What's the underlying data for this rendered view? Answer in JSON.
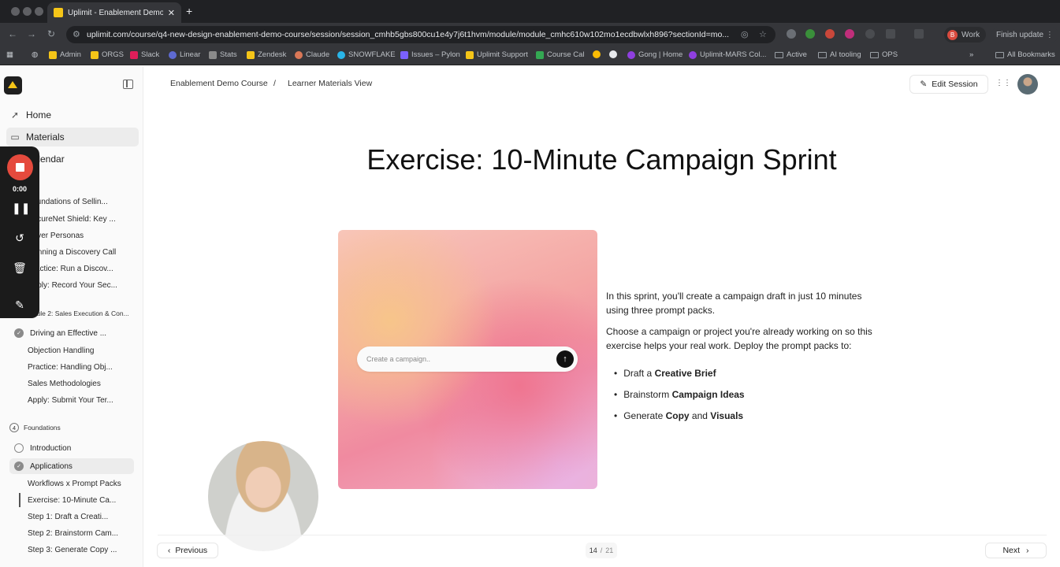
{
  "browser": {
    "tab_title": "Uplimit - Enablement Demo C",
    "url": "uplimit.com/course/q4-new-design-enablement-demo-course/session/session_cmhb5gbs800cu1e4y7j6t1hvm/module/module_cmhc610w102mo1ecdbwlxh896?sectionId=mo...",
    "profile_label": "Work",
    "profile_initial": "B",
    "finish_update": "Finish update",
    "bookmarks": [
      "Admin",
      "ORGS",
      "Slack",
      "Linear",
      "Stats",
      "Zendesk",
      "Claude",
      "SNOWFLAKE",
      "Issues – Pylon",
      "Uplimit Support",
      "Course Cal",
      "Gong | Home",
      "Uplimit-MARS Col...",
      "Active",
      "AI tooling",
      "OPS"
    ],
    "all_bookmarks": "All Bookmarks"
  },
  "sidebar": {
    "nav": [
      {
        "label": "Home",
        "icon": "rocket-icon"
      },
      {
        "label": "Materials",
        "icon": "book-icon"
      },
      {
        "label": "Calendar",
        "icon": "calendar-icon"
      }
    ],
    "module1_lessons": [
      "Foundations of Sellin...",
      "SecureNet Shield: Key ...",
      "Buyer Personas",
      "Running a Discovery Call",
      "Practice: Run a Discov...",
      "Apply: Record Your Sec..."
    ],
    "module2_label": "Module 2: Sales Execution & Con...",
    "module2_section": "Driving an Effective ...",
    "module2_lessons": [
      "Objection Handling",
      "Practice: Handling Obj...",
      "Sales Methodologies",
      "Apply: Submit Your Ter..."
    ],
    "module4_number": "4",
    "module4_label": "Foundations",
    "module4_sections": [
      "Introduction",
      "Applications"
    ],
    "module4_lessons": [
      "Workflows x Prompt Packs",
      "Exercise: 10-Minute Ca...",
      "Step 1: Draft a Creati...",
      "Step 2: Brainstorm Cam...",
      "Step 3: Generate Copy ..."
    ]
  },
  "recorder": {
    "time": "0:00"
  },
  "header": {
    "breadcrumb_course": "Enablement Demo Course",
    "breadcrumb_sep": "/",
    "breadcrumb_page": "Learner Materials View",
    "edit_label": "Edit Session"
  },
  "content": {
    "title": "Exercise: 10-Minute Campaign Sprint",
    "search_placeholder": "Create a campaign..",
    "para1": "In this sprint, you'll create a campaign draft in just 10 minutes using three prompt packs.",
    "para2": "Choose a campaign or project you're already working on so this exercise helps your real work. Deploy the prompt packs to:",
    "bullets": [
      {
        "pre": "Draft a ",
        "bold1": "Creative Brief",
        "mid": "",
        "bold2": ""
      },
      {
        "pre": "Brainstorm ",
        "bold1": "Campaign Ideas",
        "mid": "",
        "bold2": ""
      },
      {
        "pre": "Generate ",
        "bold1": "Copy",
        "mid": " and ",
        "bold2": "Visuals"
      }
    ]
  },
  "footer": {
    "previous": "Previous",
    "next": "Next",
    "page_current": "14",
    "page_sep": "/",
    "page_total": "21"
  }
}
